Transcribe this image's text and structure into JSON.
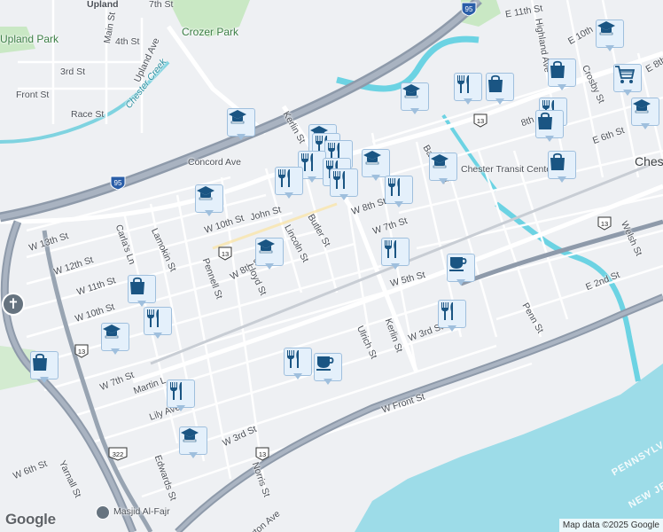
{
  "map": {
    "city_label": "Chester",
    "park_labels": [
      "Crozer Park",
      "Upland Park"
    ],
    "water_labels": [
      "Chester Creek"
    ],
    "state_labels": [
      "PENNSYLVANIA",
      "NEW JERSEY"
    ],
    "place_labels": [
      "Upland",
      "Chester Transit Center",
      "Masjid Al-Fajr"
    ],
    "street_labels": [
      "E 11th St",
      "W 13th St",
      "W 12th St",
      "W 11th St",
      "W 10th St",
      "W 10th St",
      "W 8th St",
      "W 8th St",
      "W 7th St",
      "W 7th St",
      "W 5th St",
      "W 3rd St",
      "W 3rd St",
      "W 6th St",
      "W Front St",
      "E 2nd St",
      "E 6th St",
      "E 10th",
      "E 8th",
      "4th St",
      "3rd St",
      "Front St",
      "Race St",
      "Main St",
      "Upland Ave",
      "Concord Ave",
      "John St",
      "Kerlin St",
      "Kerlin St",
      "Lamokin St",
      "Pennell St",
      "Lloyd St",
      "Butler St",
      "Lincoln St",
      "Barclay St",
      "Ulrich St",
      "Penn St",
      "Welsh St",
      "Crosby St",
      "Carla's Ln",
      "Martin L",
      "Lily Ave",
      "Edwards St",
      "Yarnall St",
      "Norris St",
      "Morton Ave",
      "Highland Ave",
      "7th St",
      "8th"
    ],
    "route_shields": [
      "95",
      "95",
      "13",
      "13",
      "13",
      "13",
      "13",
      "322",
      "BUS 13",
      "BUS 13",
      "BUS 13"
    ],
    "attribution": "Map data ©2025 Google",
    "logo_text": "Google"
  },
  "pois": [
    {
      "type": "school",
      "label": "school-icon"
    },
    {
      "type": "school",
      "label": "school-icon"
    },
    {
      "type": "school",
      "label": "school-icon"
    },
    {
      "type": "school",
      "label": "school-icon"
    },
    {
      "type": "school",
      "label": "school-icon"
    },
    {
      "type": "school",
      "label": "school-icon"
    },
    {
      "type": "school",
      "label": "school-icon"
    },
    {
      "type": "school",
      "label": "school-icon"
    },
    {
      "type": "school",
      "label": "school-icon"
    },
    {
      "type": "school",
      "label": "school-icon"
    },
    {
      "type": "school",
      "label": "school-icon"
    },
    {
      "type": "restaurant",
      "label": "restaurant-icon"
    },
    {
      "type": "restaurant",
      "label": "restaurant-icon"
    },
    {
      "type": "restaurant",
      "label": "restaurant-icon"
    },
    {
      "type": "restaurant",
      "label": "restaurant-icon"
    },
    {
      "type": "restaurant",
      "label": "restaurant-icon"
    },
    {
      "type": "restaurant",
      "label": "restaurant-icon"
    },
    {
      "type": "restaurant",
      "label": "restaurant-icon"
    },
    {
      "type": "restaurant",
      "label": "restaurant-icon"
    },
    {
      "type": "restaurant",
      "label": "restaurant-icon"
    },
    {
      "type": "restaurant",
      "label": "restaurant-icon"
    },
    {
      "type": "restaurant",
      "label": "restaurant-icon"
    },
    {
      "type": "restaurant",
      "label": "restaurant-icon"
    },
    {
      "type": "restaurant",
      "label": "restaurant-icon"
    },
    {
      "type": "restaurant",
      "label": "restaurant-icon"
    },
    {
      "type": "shopping",
      "label": "shopping-bag-icon"
    },
    {
      "type": "shopping",
      "label": "shopping-bag-icon"
    },
    {
      "type": "shopping",
      "label": "shopping-bag-icon"
    },
    {
      "type": "shopping",
      "label": "shopping-bag-icon"
    },
    {
      "type": "shopping",
      "label": "shopping-bag-icon"
    },
    {
      "type": "shopping",
      "label": "shopping-bag-icon"
    },
    {
      "type": "cart",
      "label": "shopping-cart-icon"
    },
    {
      "type": "cafe",
      "label": "coffee-cup-icon"
    },
    {
      "type": "cafe",
      "label": "coffee-cup-icon"
    }
  ],
  "colors": {
    "land": "#eef0f3",
    "water": "#9ddce8",
    "river": "#6cd3e3",
    "park": "#c9e8c4",
    "highway": "#8e9aaa",
    "major_road": "#ffffff",
    "poi_fill": "#e4f0fb",
    "poi_icon": "#1a5583"
  }
}
